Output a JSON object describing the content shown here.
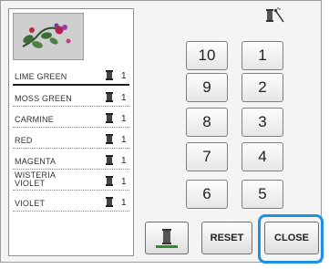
{
  "threads": [
    {
      "name": "LIME GREEN",
      "count": "1",
      "selected": true
    },
    {
      "name": "MOSS GREEN",
      "count": "1"
    },
    {
      "name": "CARMINE",
      "count": "1"
    },
    {
      "name": "RED",
      "count": "1"
    },
    {
      "name": "MAGENTA",
      "count": "1"
    },
    {
      "name": "WISTERIA VIOLET",
      "count": "1"
    },
    {
      "name": "VIOLET",
      "count": "1"
    }
  ],
  "keypad": {
    "k10": "10",
    "k1": "1",
    "k9": "9",
    "k2": "2",
    "k8": "8",
    "k3": "3",
    "k7": "7",
    "k4": "4",
    "k6": "6",
    "k5": "5"
  },
  "buttons": {
    "reset": "RESET",
    "close": "CLOSE"
  },
  "colors": {
    "highlight": "#1e90e6",
    "preview_bg": "#cfcfcf"
  },
  "icons": {
    "top": "spool-and-needle-icon",
    "spool_button": "spool-select-icon",
    "thread_spool": "thread-spool-icon"
  }
}
